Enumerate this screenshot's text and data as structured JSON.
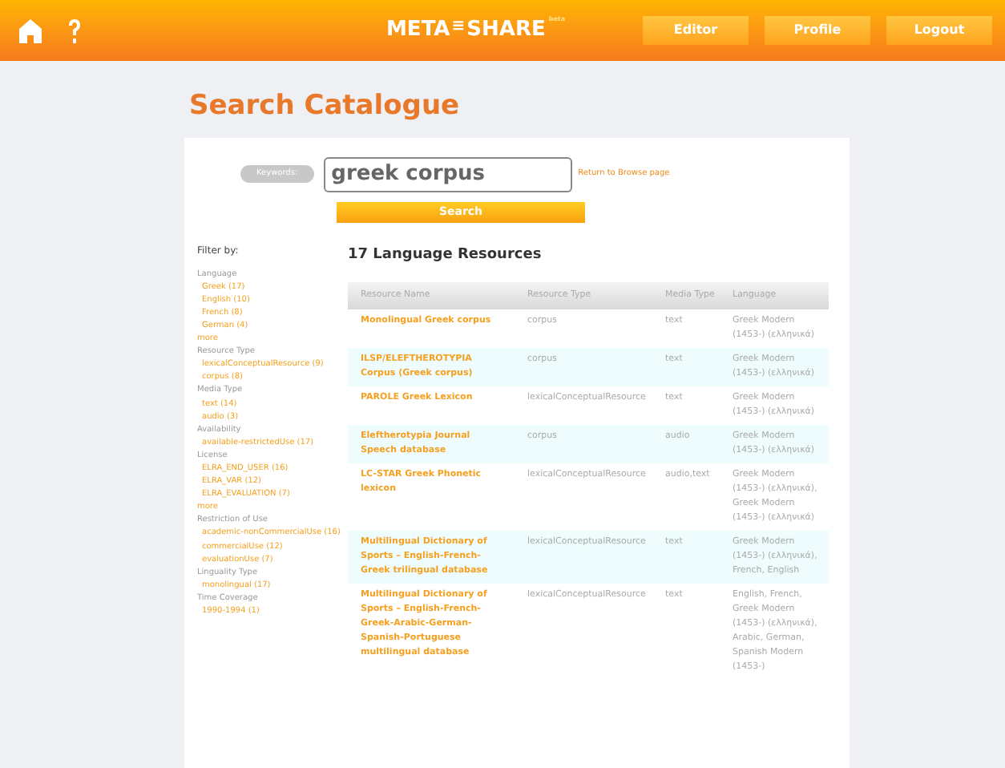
{
  "topbar": {
    "logo": "META",
    "logo_mark": "≡",
    "logo_tail": "SHARE",
    "logo_sup": "beta",
    "buttons": [
      "Editor",
      "Profile",
      "Logout"
    ]
  },
  "page_title": "Search Catalogue",
  "search": {
    "label": "Keywords:",
    "value": "greek corpus",
    "return_link": "Return to Browse page",
    "button": "Search"
  },
  "filters": {
    "title": "Filter by:",
    "groups": [
      {
        "name": "Language",
        "items": [
          "Greek (17)",
          "English (10)",
          "French (8)",
          "German (4)"
        ],
        "more": "more"
      },
      {
        "name": "Resource Type",
        "items": [
          "lexicalConceptualResource (9)",
          "corpus (8)"
        ]
      },
      {
        "name": "Media Type",
        "items": [
          "text (14)",
          "audio (3)"
        ]
      },
      {
        "name": "Availability",
        "items": [
          "available-restrictedUse (17)"
        ]
      },
      {
        "name": "License",
        "items": [
          "ELRA_END_USER (16)",
          "ELRA_VAR (12)",
          "ELRA_EVALUATION (7)"
        ],
        "more": "more"
      },
      {
        "name": "Restriction of Use",
        "items": [
          "academic-nonCommercialUse (16)",
          "commercialUse (12)",
          "evaluationUse (7)"
        ]
      },
      {
        "name": "Linguality Type",
        "items": [
          "monolingual (17)"
        ]
      },
      {
        "name": "Time Coverage",
        "items": [
          "1990-1994 (1)"
        ]
      }
    ]
  },
  "results": {
    "title": "17 Language Resources",
    "columns": [
      "Resource Name",
      "Resource Type",
      "Media Type",
      "Language"
    ],
    "rows": [
      {
        "name": "Monolingual Greek corpus",
        "type": "corpus",
        "media": "text",
        "language": "Greek Modern (1453-) (ελληνικά)"
      },
      {
        "name": "ILSP/ELEFTHEROTYPIA Corpus (Greek corpus)",
        "type": "corpus",
        "media": "text",
        "language": "Greek Modern (1453-) (ελληνικά)"
      },
      {
        "name": "PAROLE Greek Lexicon",
        "type": "lexicalConceptualResource",
        "media": "text",
        "language": "Greek Modern (1453-) (ελληνικά)"
      },
      {
        "name": "Eleftherotypia Journal Speech database",
        "type": "corpus",
        "media": "audio",
        "language": "Greek Modern (1453-) (ελληνικά)"
      },
      {
        "name": "LC-STAR Greek Phonetic lexicon",
        "type": "lexicalConceptualResource",
        "media": "audio,text",
        "language": "Greek Modern (1453-) (ελληνικά), Greek Modern (1453-) (ελληνικά)"
      },
      {
        "name": "Multilingual Dictionary of Sports – English-French-Greek trilingual database",
        "type": "lexicalConceptualResource",
        "media": "text",
        "language": "Greek Modern (1453-) (ελληνικά), French, English"
      },
      {
        "name": "Multilingual Dictionary of Sports – English-French-Greek-Arabic-German-Spanish-Portuguese multilingual database",
        "type": "lexicalConceptualResource",
        "media": "text",
        "language": "English, French, Greek Modern (1453-) (ελληνικά), Arabic, German, Spanish Modern (1453-)"
      }
    ]
  }
}
